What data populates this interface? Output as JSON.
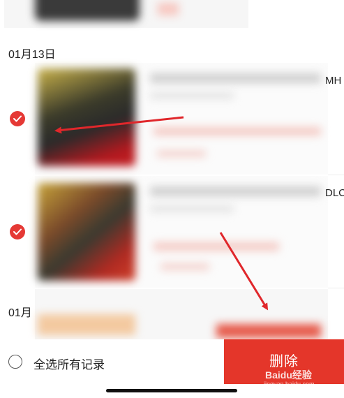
{
  "list": {
    "groups": [
      {
        "date": "01月13日",
        "items": [
          {
            "selected": true,
            "title_tail": "MH"
          },
          {
            "selected": true,
            "title_tail": "DLC"
          }
        ]
      },
      {
        "date": "01月"
      }
    ]
  },
  "footer": {
    "select_all_label": "全选所有记录",
    "delete_label": "删除"
  },
  "watermark": {
    "text": "Baidu经验",
    "url_text": "jingyan.baidu.com"
  },
  "colors": {
    "accent": "#e4362a",
    "check": "#e53935",
    "arrow": "#e0272b"
  }
}
